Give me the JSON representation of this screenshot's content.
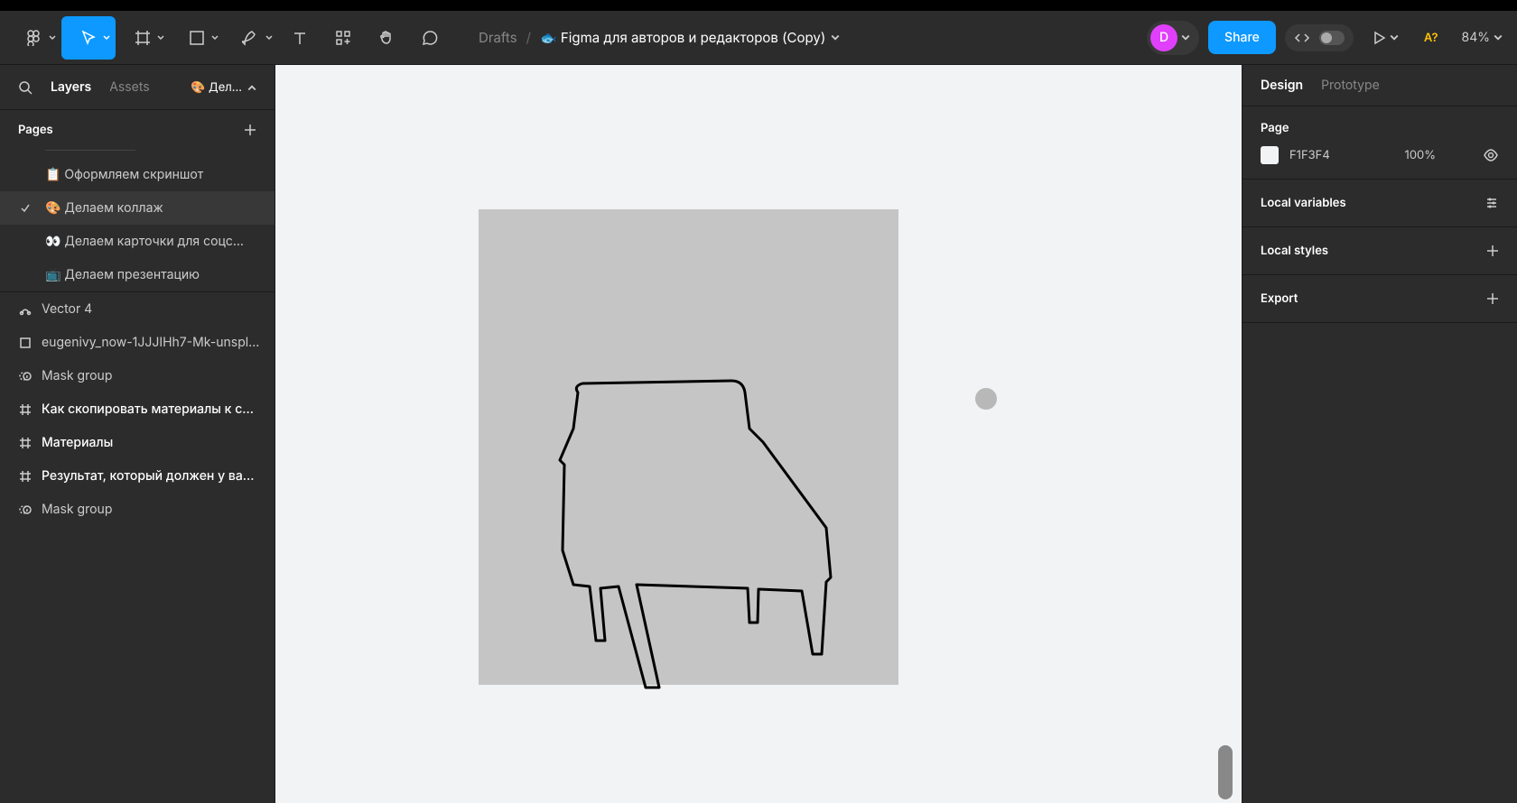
{
  "breadcrumb": {
    "drafts": "Drafts",
    "sep": "/",
    "title": "🐟 Figma для авторов и редакторов (Copy)"
  },
  "avatar": {
    "initial": "D"
  },
  "share": {
    "label": "Share"
  },
  "qa": {
    "label": "A?"
  },
  "zoom": {
    "value": "84%"
  },
  "leftPanel": {
    "tabs": {
      "layers": "Layers",
      "assets": "Assets"
    },
    "pageSelector": "🎨 Дел...",
    "pagesHeader": "Pages",
    "pages": [
      {
        "label": "📋 Оформляем скриншот",
        "selected": false
      },
      {
        "label": "🎨 Делаем коллаж",
        "selected": true
      },
      {
        "label": "👀 Делаем карточки для соцс...",
        "selected": false
      },
      {
        "label": "📺 Делаем презентацию",
        "selected": false
      }
    ],
    "layers": [
      {
        "label": "Vector 4",
        "type": "vector",
        "bold": false
      },
      {
        "label": "eugenivy_now-1JJJIHh7-Mk-unspl...",
        "type": "rect",
        "bold": false
      },
      {
        "label": "Mask group",
        "type": "mask",
        "bold": false
      },
      {
        "label": "Как скопировать материалы к с...",
        "type": "frame",
        "bold": true
      },
      {
        "label": "Материалы",
        "type": "frame",
        "bold": true
      },
      {
        "label": "Результат, который должен у ва...",
        "type": "frame",
        "bold": true
      },
      {
        "label": "Mask group",
        "type": "mask",
        "bold": false
      }
    ]
  },
  "rightPanel": {
    "tabs": {
      "design": "Design",
      "prototype": "Prototype"
    },
    "page": {
      "title": "Page",
      "color": "F1F3F4",
      "opacity": "100%"
    },
    "localVariables": "Local variables",
    "localStyles": "Local styles",
    "export": "Export"
  }
}
